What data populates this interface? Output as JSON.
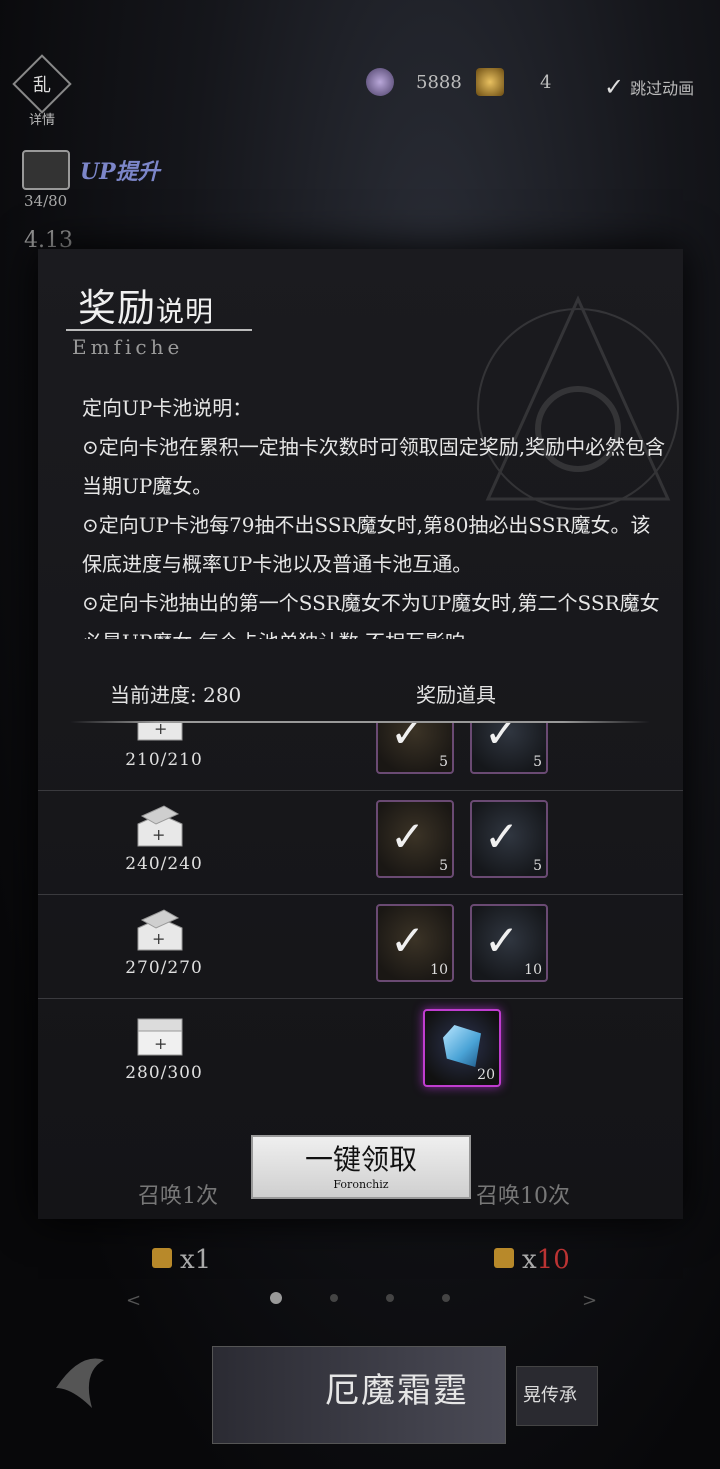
{
  "topbar": {
    "detail_icon_char": "乱",
    "detail_label": "详情",
    "currency1_value": "5888",
    "currency2_value": "4",
    "skip_label": "跳过动画"
  },
  "up": {
    "label": "UP提升",
    "progress": "34/80",
    "underlay_value": "4.13"
  },
  "modal": {
    "title_big": "奖励",
    "title_small": "说明",
    "subtitle": "Emfiche",
    "description": [
      "定向UP卡池说明：",
      "⊙定向卡池在累积一定抽卡次数时可领取固定奖励,奖励中必然包含当期UP魔女。",
      "⊙定向UP卡池每79抽不出SSR魔女时,第80抽必出SSR魔女。该保底进度与概率UP卡池以及普通卡池互通。",
      "⊙定向卡池抽出的第一个SSR魔女不为UP魔女时,第二个SSR魔女必是UP魔女,每个卡池单独计数,不相互影响。"
    ],
    "progress_header": "当前进度: 280",
    "reward_header": "奖励道具",
    "rows": [
      {
        "progress": "210/210",
        "items": [
          {
            "qty": "5"
          },
          {
            "qty": "5"
          }
        ]
      },
      {
        "progress": "240/240",
        "items": [
          {
            "qty": "5"
          },
          {
            "qty": "5"
          }
        ]
      },
      {
        "progress": "270/270",
        "items": [
          {
            "qty": "10"
          },
          {
            "qty": "10"
          }
        ]
      },
      {
        "progress": "280/300",
        "items": [
          {
            "qty": "20"
          }
        ]
      }
    ],
    "claim_label": "一键领取",
    "claim_sub": "Foronchiz"
  },
  "bottom": {
    "summon1_label": "召唤1次",
    "summon10_label": "召唤10次",
    "cost1": "x1",
    "cost10_prefix": "x",
    "cost10_value": "10",
    "banner_title": "厄魔霜霆",
    "banner2_title": "晃传承"
  },
  "colors": {
    "accent_purple": "#c03dd0",
    "up_blue": "#7c86c9"
  }
}
